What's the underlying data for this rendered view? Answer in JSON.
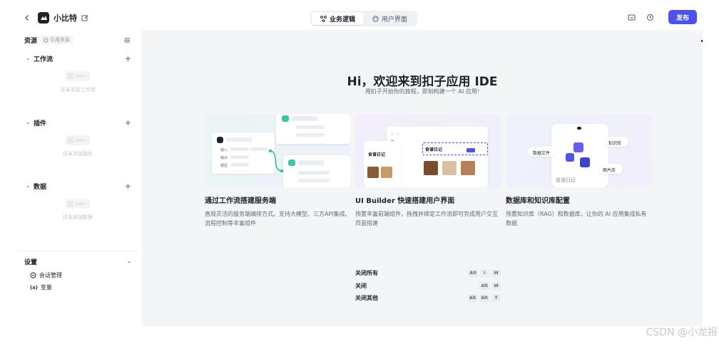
{
  "header": {
    "app_name": "小比特",
    "tabs": [
      {
        "label": "业务逻辑",
        "active": true
      },
      {
        "label": "用户界面",
        "active": false
      }
    ],
    "publish_label": "发布",
    "accent": "#4d53e8"
  },
  "sidebar": {
    "title": "资源",
    "ref_badge": "引用关系",
    "sections": [
      {
        "label": "工作流",
        "empty": "还未添加工作流"
      },
      {
        "label": "插件",
        "empty": "还未添加插件"
      },
      {
        "label": "数据",
        "empty": "还未添加数据"
      }
    ],
    "settings": {
      "title": "设置",
      "items": [
        {
          "label": "会话管理",
          "icon": "chat-icon"
        },
        {
          "label": "变量",
          "icon": "variable-icon"
        }
      ]
    }
  },
  "main": {
    "title": "Hi，欢迎来到扣子应用 IDE",
    "subtitle": "用扣子开始你的旅程，即刻构建一个 AI 应用!",
    "cards": [
      {
        "title": "通过工作流搭建服务端",
        "desc": "直观灵活的服务端编排方式。支持大模型、三方API集成、流程控制等丰富组件",
        "ill_labels": [
          "输入",
          "输出",
          "模型"
        ]
      },
      {
        "title": "UI Builder 快速搭建用户界面",
        "desc": "预置丰富前端组件，拖拽并绑定工作流即可完成用户交互页面搭建",
        "ill_labels": [
          "食谱日记",
          "食谱日记"
        ]
      },
      {
        "title": "数据库和知识库配置",
        "desc": "预置知识库（RAG）和数据库，让你的 AI 应用集成私有数据",
        "ill_labels": [
          "数据文件",
          "知识库",
          "图片库",
          "食谱日记"
        ]
      }
    ],
    "shortcuts": [
      {
        "label": "关闭所有",
        "keys": [
          "Alt",
          "⇧",
          "W"
        ]
      },
      {
        "label": "关闭",
        "keys": [
          "Alt",
          "W"
        ]
      },
      {
        "label": "关闭其他",
        "keys": [
          "Alt",
          "Alt",
          "T"
        ]
      }
    ]
  },
  "watermark": "CSDN @小龙报"
}
